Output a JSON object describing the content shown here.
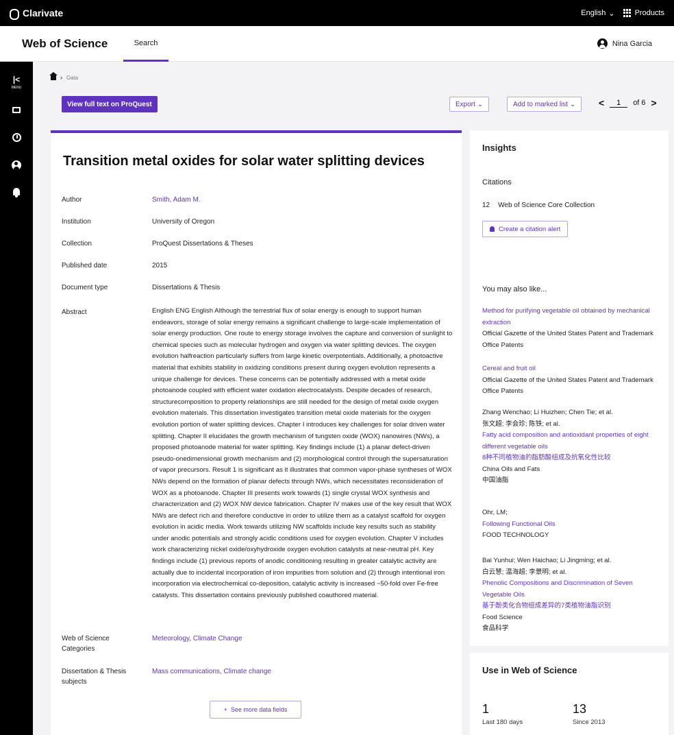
{
  "topbar": {
    "brand": "Clarivate",
    "language": "English",
    "products": "Products"
  },
  "header": {
    "title": "Web of Science",
    "nav_search": "Search",
    "user_name": "Nina Garcia"
  },
  "rail": {
    "collapse_label": "MENU"
  },
  "breadcrumb": {
    "current": "Gaia"
  },
  "actions": {
    "full_text": "View full text on ProQuest",
    "export": "Export",
    "add_to_marked_list": "Add to marked list",
    "page_current": "1",
    "page_total": "of 6"
  },
  "record": {
    "title": "Transition metal oxides for solar water splitting devices",
    "fields": [
      {
        "label": "Author",
        "value": "Smith, Adam M."
      },
      {
        "label": "Institution",
        "value": "University of Oregon"
      },
      {
        "label": "Collection",
        "value": "ProQuest Dissertations & Theses"
      },
      {
        "label": "Published date",
        "value": "2015"
      },
      {
        "label": "Document type",
        "value": "Dissertations & Thesis"
      },
      {
        "label": "Abstract",
        "value": "English ENG English Although the terrestrial flux of solar energy is enough to support human endeavors, storage of solar energy remains a significant challenge to large-scale implementation of solar energy production. One route to energy storage involves the capture and conversion of sunlight to chemical species such as molecular hydrogen and oxygen via water splitting devices. The oxygen evolution halfreaction particularly suffers from large kinetic overpotentials. Additionally, a photoactive material that exhibits stability in oxidizing conditions present during oxygen evolution represents a unique challenge for devices. These concerns can be potentially addressed with a metal oxide photoanode coupled with efficient water oxidation electrocatalysts. Despite decades of research, structurecomposition to property relationships are still needed for the design of metal oxide oxygen evolution materials. This dissertation investigates transition metal oxide materials for the oxygen evolution portion of water splitting devices. Chapter I introduces key challenges for solar driven water splitting. Chapter II elucidates the growth mechanism of tungsten oxide (WOX) nanowires (NWs), a proposed photoanode material for water splitting. Key findings include (1) a planar defect-driven pseudo-onedimensional growth mechanism and (2) morphological control through the supersaturation of vapor precursors. Result 1 is significant as it illustrates that common vapor-phase syntheses of WOX NWs depend on the formation of planar defects through NWs, which necessitates reconsideration of WOX as a photoanode. Chapter III presents work towards (1) single crystal WOX synthesis and characterization and (2) WOX NW device fabrication. Chapter IV makes use of the key result that WOX NWs are defect rich and therefore conductive in order to utilize them as a catalyst scaffold for oxygen evolution in acidic media. Work towards utilizing NW scaffolds include key results such as stability under anodic potentials and strongly acidic conditions used for oxygen evolution. Chapter V includes work characterizing nickel oxide/oxyhydroxide oxygen evolution catalysts at near-neutral pH. Key findings include (1) previous reports of anodic conditioning resulting in greater catalytic activity are actually due to incidental incorporation of iron impurities from solution and (2) through intentional iron incorporation via electrochemical co-deposition, catalytic activity is increased ~50-fold over Fe-free catalysts. This dissertation contains previously published coauthored material."
      },
      {
        "label": "Web of Science Categories",
        "value": "Meteorology, Climate Change"
      },
      {
        "label": "Dissertation & Thesis subjects",
        "value": "Mass communications, Climate change"
      }
    ],
    "see_more": "See more data fields"
  },
  "insights": {
    "title": "Insights",
    "citations_label": "Citations",
    "citation_count": "12",
    "citation_source": "Web of Science Core Collection",
    "alert_button": "Create a citation alert",
    "also_like": "You may also like...",
    "recommendations": [
      {
        "lines": [],
        "title": "Method for purifying vegetable oil obtained by mechanical extraction",
        "source": "Official Gazette of the United States Patent and Trademark Office Patents"
      },
      {
        "lines": [],
        "title": "Cereal and fruit oil",
        "source": "Official Gazette of the United States Patent and Trademark Office Patents"
      },
      {
        "lines": [
          "Zhang Wenchao; Li Huizhen; Chen Tie; et al.",
          "张文超; 李会珍; 陈铁; et al."
        ],
        "title": "Fatty acid composition and antioxidant properties of eight different vegetable oils",
        "title_cn": "8种不同植物油的脂肪酸组成及抗氧化性比较",
        "source": "China Oils and Fats",
        "source_cn": "中国油脂"
      },
      {
        "lines": [
          "Ohr, LM;"
        ],
        "title": "Following Functional Oils",
        "source": "FOOD TECHNOLOGY"
      },
      {
        "lines": [
          "Bai Yunhui; Wen Haichao; Li Jingming; et al.",
          "白云慧; 温海超; 李景明; et al."
        ],
        "title": "Phenolic Compositions and Discrimination of Seven Vegetable Oils",
        "title_cn": "基于酚类化合物组成差异的7类植物油脂识别",
        "source": "Food Science",
        "source_cn": "食品科学"
      }
    ]
  },
  "usage": {
    "title": "Use in Web of Science",
    "stats": [
      {
        "value": "1",
        "label": "Last 180 days"
      },
      {
        "value": "13",
        "label": "Since 2013"
      }
    ]
  }
}
